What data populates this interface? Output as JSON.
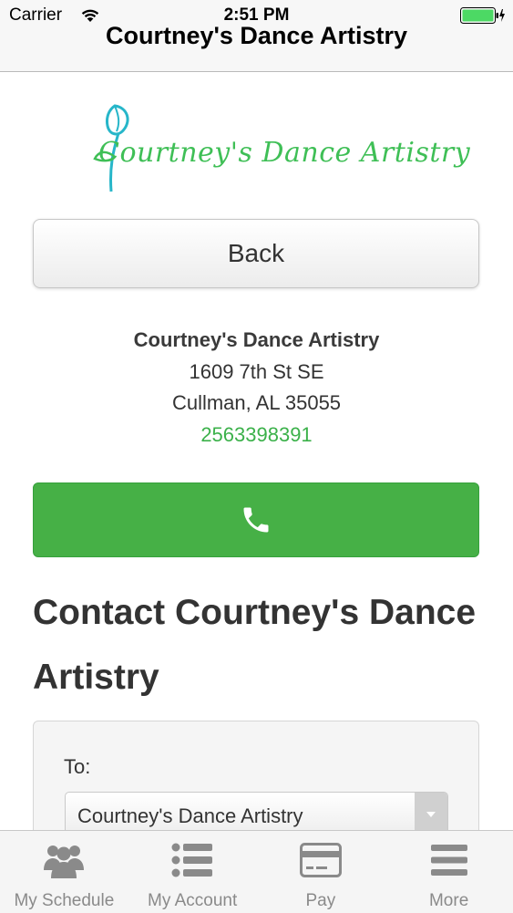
{
  "status_bar": {
    "carrier": "Carrier",
    "time": "2:51 PM"
  },
  "nav": {
    "title": "Courtney's Dance Artistry"
  },
  "logo": {
    "text": "Courtney's Dance Artistry",
    "color": "#3fbf56"
  },
  "back_button": {
    "label": "Back"
  },
  "address": {
    "name": "Courtney's Dance Artistry",
    "street": "1609 7th St SE",
    "city": "Cullman, AL 35055",
    "phone": "2563398391"
  },
  "call_button": {
    "icon": "phone-icon",
    "color": "#46b046"
  },
  "contact": {
    "heading": "Contact Courtney's Dance Artistry",
    "to_label": "To:",
    "to_value": "Courtney's Dance Artistry"
  },
  "tabbar": {
    "items": [
      {
        "label": "My Schedule",
        "icon": "people-icon"
      },
      {
        "label": "My Account",
        "icon": "list-icon"
      },
      {
        "label": "Pay",
        "icon": "card-icon"
      },
      {
        "label": "More",
        "icon": "menu-icon"
      }
    ]
  }
}
